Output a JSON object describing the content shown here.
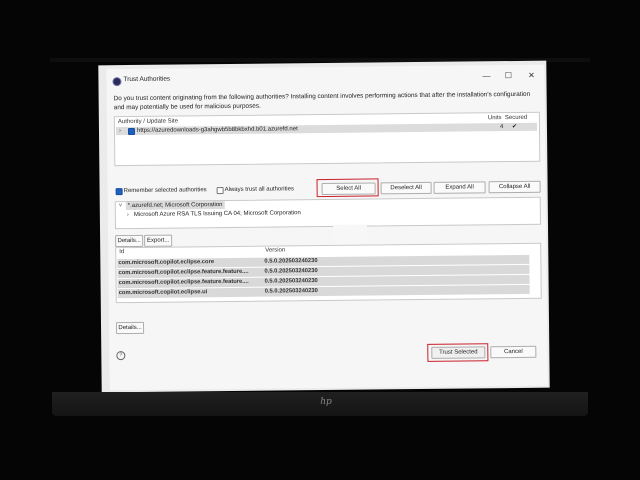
{
  "dialog": {
    "title": "Trust Authorities",
    "question": "Do you trust content originating from the following authorities?  Installing content involves performing actions that after the installation's configuration and may potentially be used for malicious purposes.",
    "window_controls": {
      "minimize": "—",
      "maximize": "☐",
      "close": "✕"
    }
  },
  "authorities": {
    "columns": {
      "site": "Authority / Update Site",
      "units": "Units",
      "secured": "Secured"
    },
    "rows": [
      {
        "url": "https://azuredownloads-g3ahgwb5b8bkbxhd.b01.azurefd.net",
        "units": "4",
        "secured_icon": "✔",
        "checked": true
      }
    ]
  },
  "options": {
    "remember": "Remember selected authorities",
    "always_trust": "Always trust all authorities"
  },
  "buttons": {
    "select_all": "Select All",
    "deselect_all": "Deselect All",
    "expand_all": "Expand All",
    "collapse_all": "Collapse All",
    "details": "Details...",
    "export": "Export...",
    "details2": "Details...",
    "trust_selected": "Trust Selected",
    "cancel": "Cancel"
  },
  "certificates": {
    "root": "*.azurefd.net; Microsoft Corporation",
    "child": "Microsoft Azure RSA TLS Issuing CA 04; Microsoft Corporation"
  },
  "artifacts": {
    "columns": {
      "id": "Id",
      "version": "Version"
    },
    "rows": [
      {
        "id": "com.microsoft.copilot.eclipse.core",
        "version": "0.5.0.202503240230"
      },
      {
        "id": "com.microsoft.copilot.eclipse.feature.feature....",
        "version": "0.5.0.202503240230"
      },
      {
        "id": "com.microsoft.copilot.eclipse.feature.feature....",
        "version": "0.5.0.202503240230"
      },
      {
        "id": "com.microsoft.copilot.eclipse.ui",
        "version": "0.5.0.202503240230"
      }
    ]
  },
  "help_icon": "?",
  "laptop_logo": "hp",
  "colors": {
    "highlight_outline": "#c8202a",
    "checkbox_checked": "#1f5fbf"
  }
}
